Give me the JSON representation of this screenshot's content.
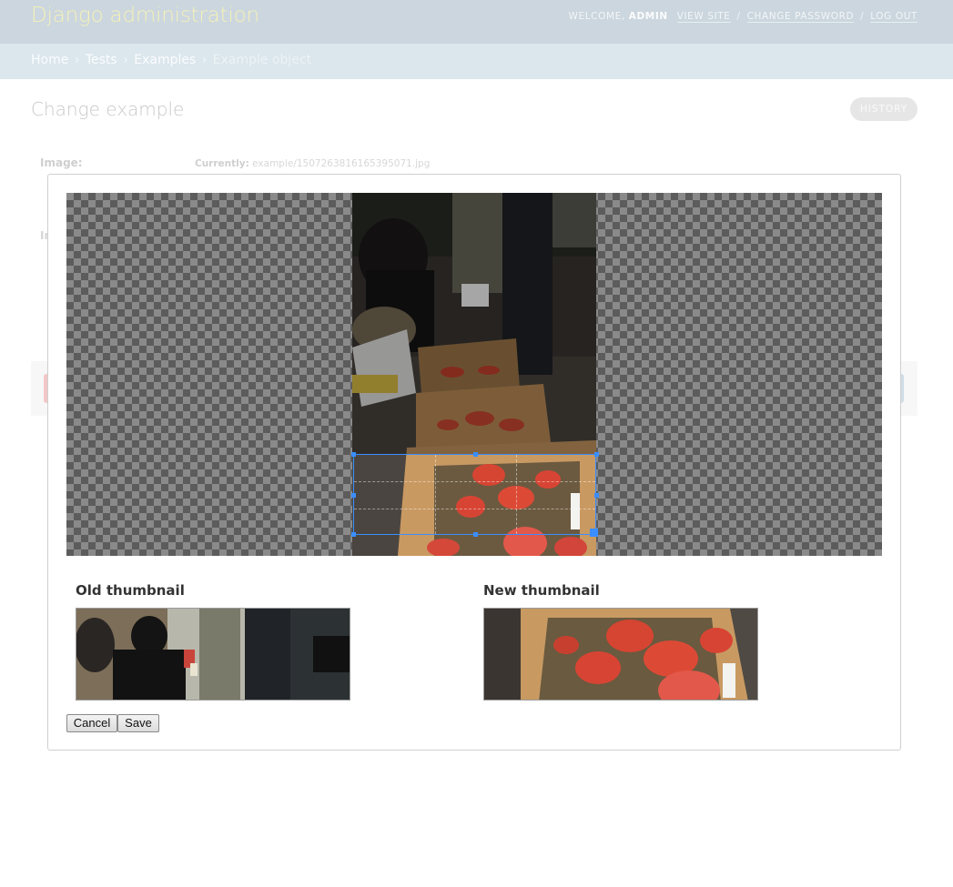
{
  "header": {
    "site_name": "Django administration",
    "welcome": "Welcome,",
    "username": "admin",
    "view_site": "View site",
    "change_password": "Change password",
    "log_out": "Log out",
    "separator": "/"
  },
  "breadcrumbs": {
    "items": [
      "Home",
      "Tests",
      "Examples"
    ],
    "current": "Example object",
    "separator": "›"
  },
  "page": {
    "title": "Change example",
    "history_label": "History",
    "image_field_label": "Image:",
    "currently_label": "Currently:",
    "currently_value": "example/1507263816165395071.jpg",
    "second_field_label": "In"
  },
  "crop_dialog": {
    "old_thumbnail_title": "Old thumbnail",
    "new_thumbnail_title": "New thumbnail",
    "cancel_label": "Cancel",
    "save_label": "Save",
    "selection_color": "#3a8eff"
  }
}
